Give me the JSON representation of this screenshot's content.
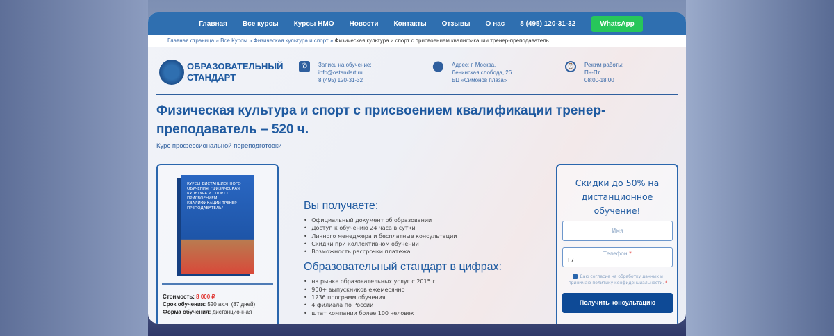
{
  "nav": {
    "items": [
      "Главная",
      "Все курсы",
      "Курсы НМО",
      "Новости",
      "Контакты",
      "Отзывы",
      "О нас",
      "8 (495) 120-31-32"
    ],
    "whatsapp": "WhatsApp"
  },
  "breadcrumb": {
    "items": [
      "Главная страница",
      "Все Курсы",
      "Физическая культура и спорт"
    ],
    "current": "Физическая культура и спорт с присвоением квалификации тренер-преподаватель",
    "sep": " » "
  },
  "logo": {
    "line1": "ОБРАЗОВАТЕЛЬНЫЙ",
    "line2": "СТАНДАРТ"
  },
  "contact": {
    "label": "Запись на обучение:",
    "email": "info@ostandart.ru",
    "phone": "8 (495) 120-31-32"
  },
  "address": {
    "line1": "Адрес: г. Москва,",
    "line2": "Ленинская слобода, 26",
    "line3": "БЦ «Симонов плаза»"
  },
  "hours": {
    "label": "Режим работы:",
    "days": "Пн-Пт",
    "time": "08:00-18:00"
  },
  "title": "Физическая культура и спорт с присвоением квалификации тренер-преподаватель – 520 ч.",
  "subtitle": "Курс профессиональной переподготовки",
  "product": {
    "box_text": "КУРСЫ ДИСТАНЦИОННОГО ОБУЧЕНИЯ: \"ФИЗИЧЕСКАЯ КУЛЬТУРА И СПОРТ С ПРИСВОЕНИЕМ КВАЛИФИКАЦИИ ТРЕНЕР-ПРЕПОДАВАТЕЛЬ\"",
    "price_label": "Стоимость:",
    "price": "8 000 ₽",
    "duration_label": "Срок обучения:",
    "duration": "520 ак.ч. (87 дней)",
    "form_label": "Форма обучения:",
    "form": "дистанционная"
  },
  "benefits": {
    "title": "Вы получаете:",
    "items": [
      "Официальный документ об образовании",
      "Доступ к обучению 24 часа в сутки",
      "Личного менеджера и бесплатные консультации",
      "Скидки при коллективном обучении",
      "Возможность рассрочки платежа"
    ]
  },
  "stats": {
    "title": "Образовательный стандарт в цифрах:",
    "items": [
      "на рынке образовательных услуг с 2015 г.",
      "900+ выпускников ежемесячно",
      "1236 программ обучения",
      "4 филиала по России",
      "штат компании более 100 человек"
    ]
  },
  "form": {
    "title": "Скидки до 50% на дистанционное обучение!",
    "name_placeholder": "Имя",
    "phone_label": "Телефон",
    "required": "*",
    "phone_value": "+7",
    "agree": "Даю согласие на обработку данных и принимаю политику конфиденциальности.",
    "submit": "Получить консультацию"
  }
}
